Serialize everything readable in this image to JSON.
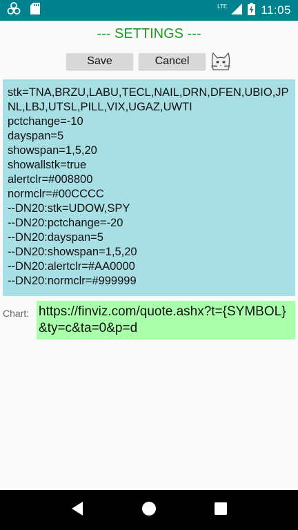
{
  "status_bar": {
    "time": "11:05",
    "network": "LTE",
    "icons": [
      "biohazard-icon",
      "sd-card-icon",
      "signal-icon",
      "battery-charging-icon"
    ]
  },
  "title": "--- SETTINGS ---",
  "buttons": {
    "save_label": "Save",
    "cancel_label": "Cancel"
  },
  "config_lines": [
    "stk=TNA,BRZU,LABU,TECL,NAIL,DRN,DFEN,UBIO,JPNL,LBJ,UTSL,PILL,VIX,UGAZ,UWTI",
    "pctchange=-10",
    "dayspan=5",
    "showspan=1,5,20",
    "showallstk=true",
    "alertclr=#008800",
    "normclr=#00CCCC",
    "--DN20:stk=UDOW,SPY",
    "--DN20:pctchange=-20",
    "--DN20:dayspan=5",
    "--DN20:showspan=1,5,20",
    "--DN20:alertclr=#AA0000",
    "--DN20:normclr=#999999"
  ],
  "chart": {
    "label": "Chart:",
    "value": "https://finviz.com/quote.ashx?t={SYMBOL}&ty=c&ta=0&p=d"
  },
  "colors": {
    "status_bar": "#00838f",
    "title": "#229922",
    "config_bg": "#a8dfe4",
    "chart_bg": "#aaffaa"
  },
  "nav_icons": [
    "back-icon",
    "home-icon",
    "recents-icon"
  ]
}
